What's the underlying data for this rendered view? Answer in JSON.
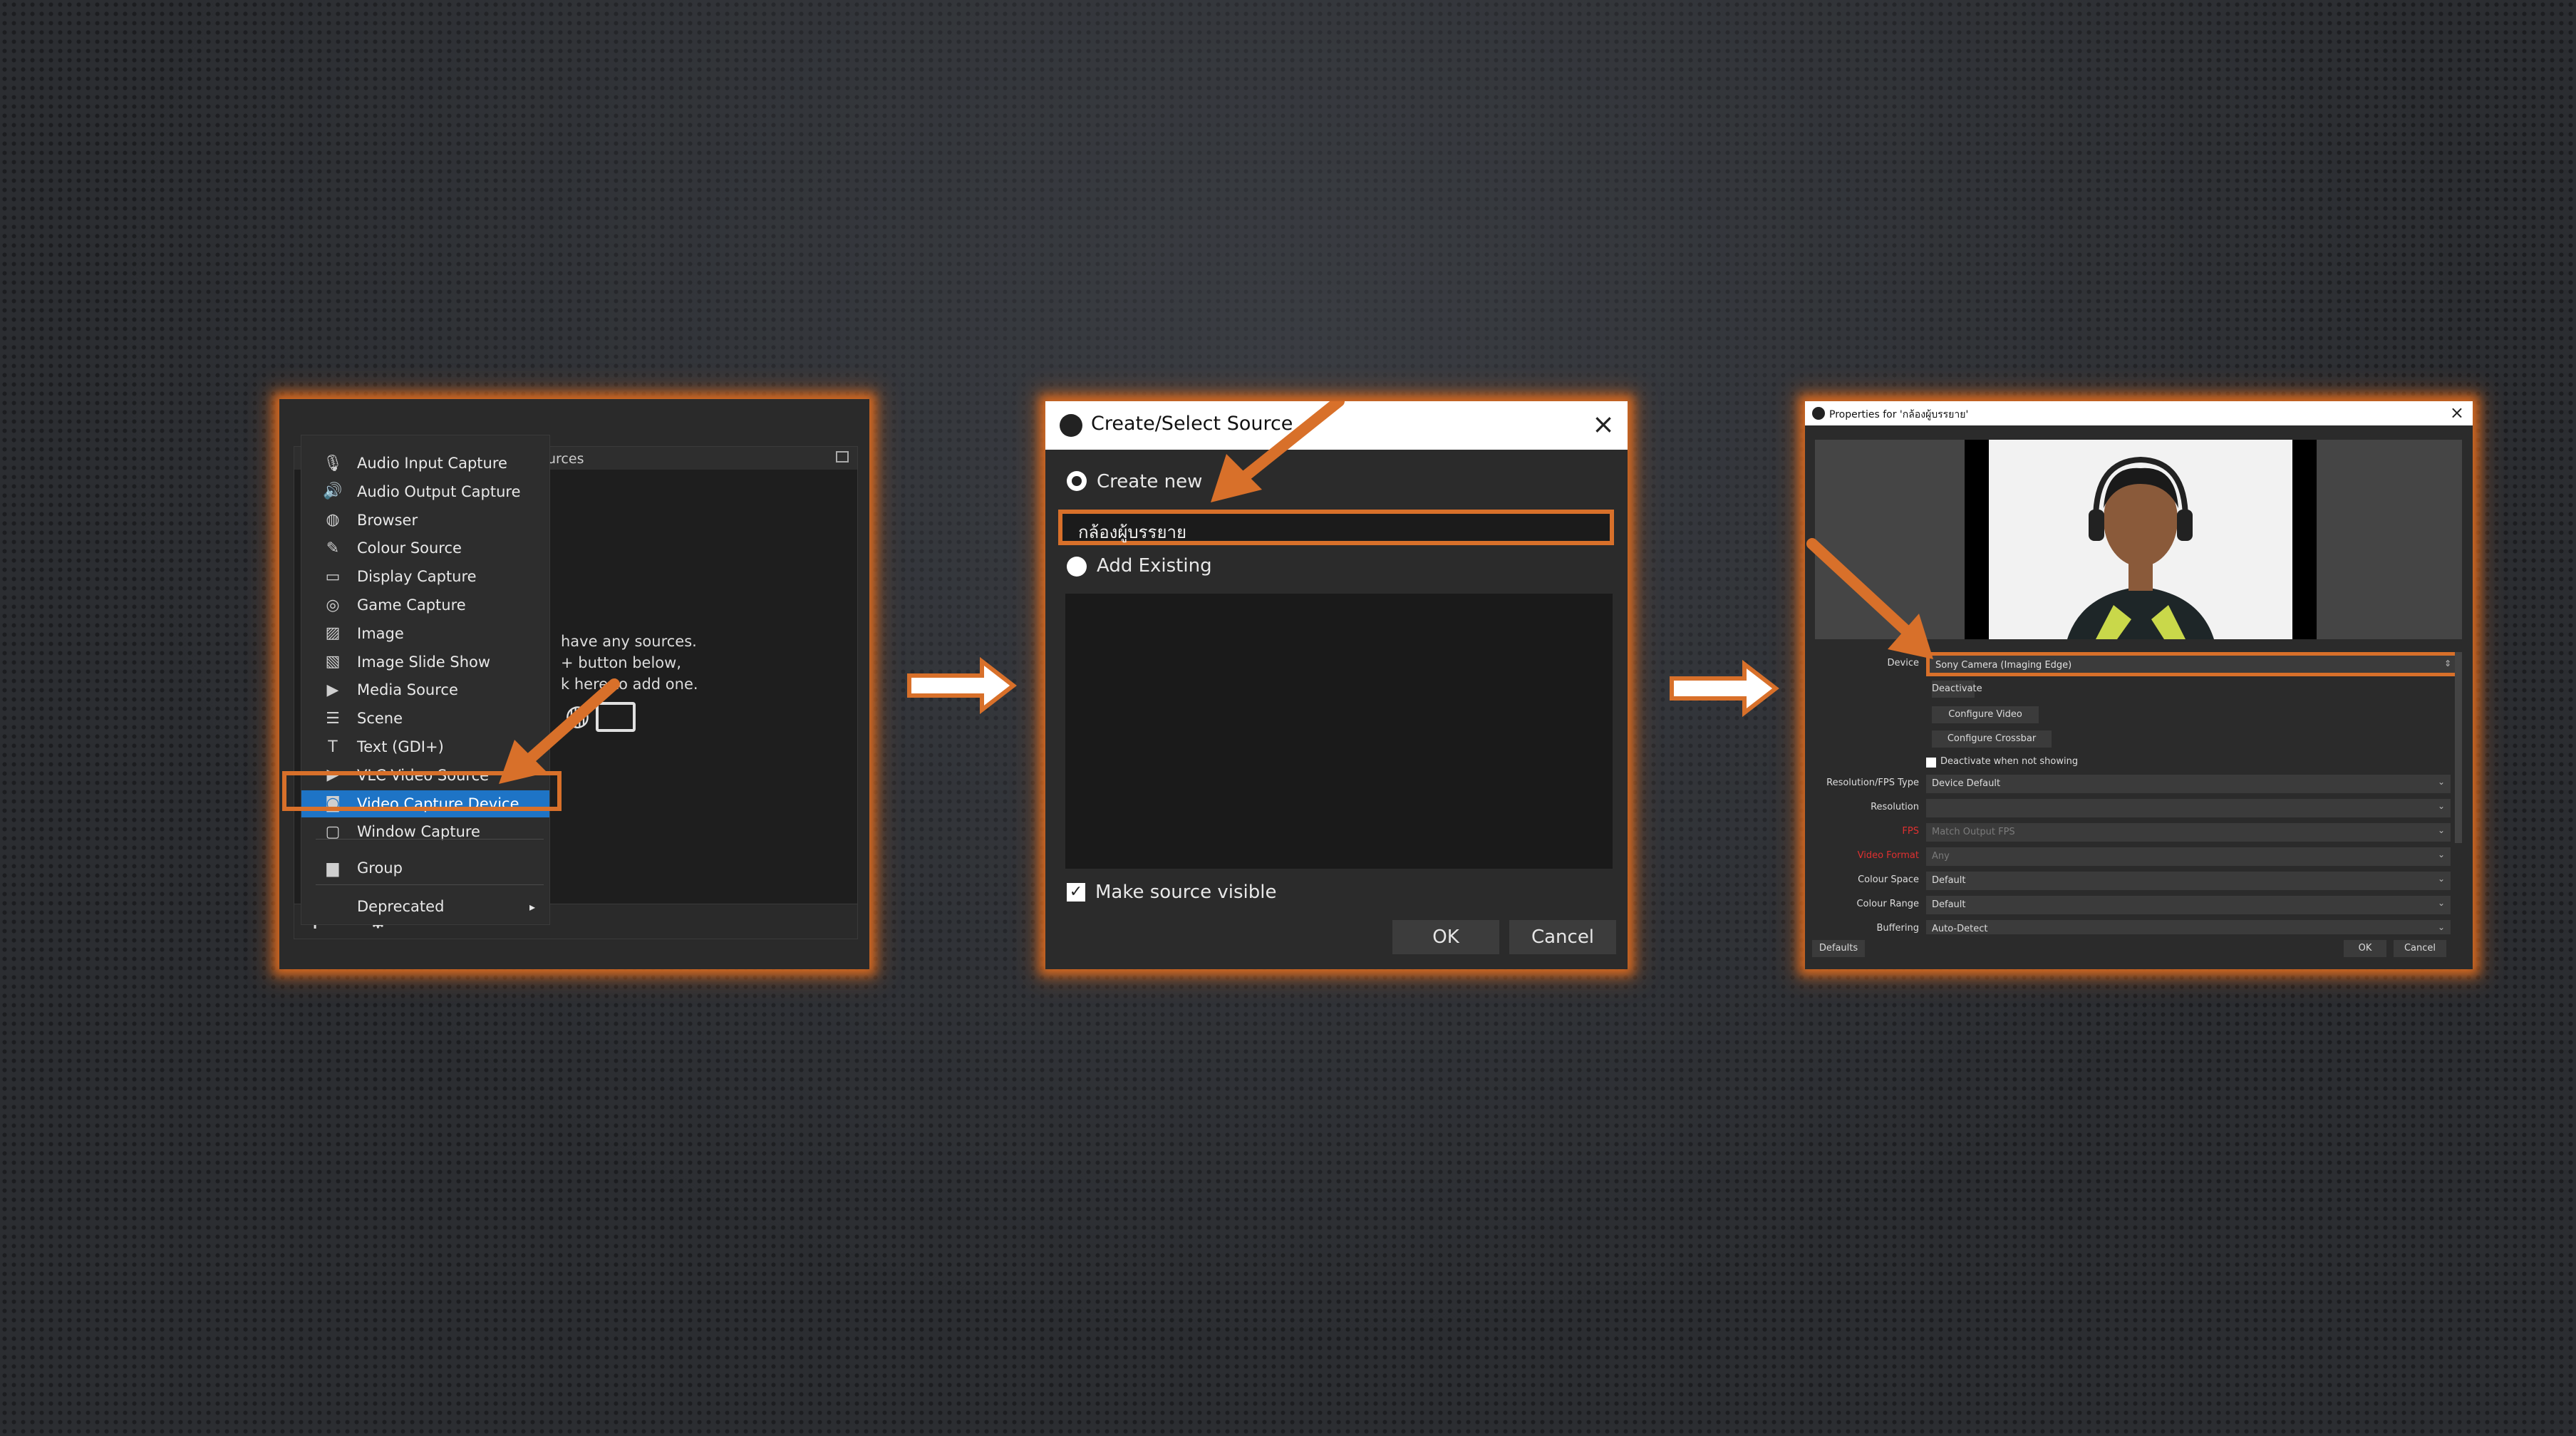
{
  "panel1": {
    "sources_header": "urces",
    "empty_text_1": "have any sources.",
    "empty_text_2": "+ button below,",
    "empty_text_3": "k here to add one.",
    "menu_items": [
      {
        "label": "Audio Input Capture",
        "icon": "microphone-icon"
      },
      {
        "label": "Audio Output Capture",
        "icon": "speaker-icon"
      },
      {
        "label": "Browser",
        "icon": "globe-icon"
      },
      {
        "label": "Colour Source",
        "icon": "paintbrush-icon"
      },
      {
        "label": "Display Capture",
        "icon": "monitor-icon"
      },
      {
        "label": "Game Capture",
        "icon": "gamepad-icon"
      },
      {
        "label": "Image",
        "icon": "image-icon"
      },
      {
        "label": "Image Slide Show",
        "icon": "slideshow-icon"
      },
      {
        "label": "Media Source",
        "icon": "play-icon"
      },
      {
        "label": "Scene",
        "icon": "list-icon"
      },
      {
        "label": "Text (GDI+)",
        "icon": "text-icon"
      },
      {
        "label": "VLC Video Source",
        "icon": "play-icon"
      },
      {
        "label": "Video Capture Device",
        "icon": "camera-icon"
      },
      {
        "label": "Window Capture",
        "icon": "window-icon"
      }
    ],
    "group_label": "Group",
    "deprecated_label": "Deprecated",
    "accent": "#1e74c6"
  },
  "panel2": {
    "title": "Create/Select Source",
    "create_new_label": "Create new",
    "name_value": "กล้องผู้บรรยาย",
    "add_existing_label": "Add Existing",
    "make_visible_label": "Make source visible",
    "ok_label": "OK",
    "cancel_label": "Cancel"
  },
  "panel3": {
    "title": "Properties for 'กล้องผู้บรรยาย'",
    "device_label": "Device",
    "device_value": "Sony Camera (Imaging Edge)",
    "deactivate_label": "Deactivate",
    "configure_video_label": "Configure Video",
    "configure_crossbar_label": "Configure Crossbar",
    "deactivate_when_not_showing": "Deactivate when not showing",
    "rows": [
      {
        "label": "Resolution/FPS Type",
        "value": "Device Default",
        "red": false
      },
      {
        "label": "Resolution",
        "value": "",
        "red": false
      },
      {
        "label": "FPS",
        "value": "Match Output FPS",
        "red": true
      },
      {
        "label": "Video Format",
        "value": "Any",
        "red": true
      },
      {
        "label": "Colour Space",
        "value": "Default",
        "red": false
      },
      {
        "label": "Colour Range",
        "value": "Default",
        "red": false
      },
      {
        "label": "Buffering",
        "value": "Auto-Detect",
        "red": false
      }
    ],
    "defaults_label": "Defaults",
    "ok_label": "OK",
    "cancel_label": "Cancel"
  },
  "colors": {
    "highlight_orange": "#d8702a",
    "panel_dark": "#1e1e1e",
    "menu_dark": "#2d2d2d",
    "selected_blue": "#1e74c6"
  }
}
